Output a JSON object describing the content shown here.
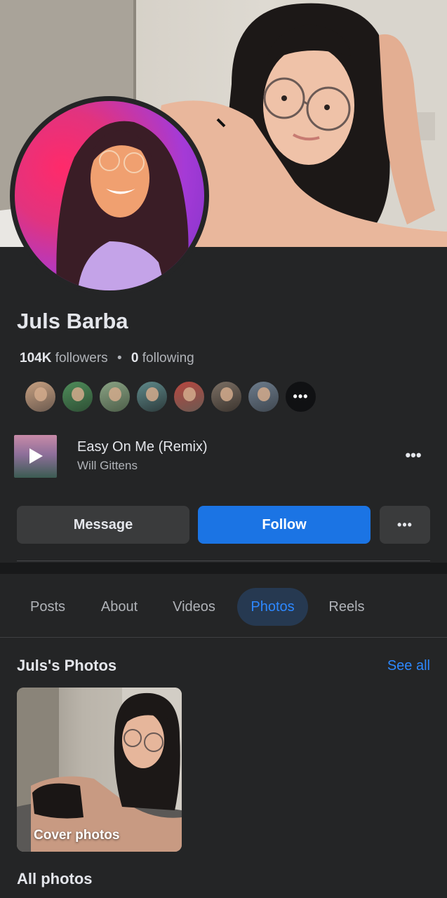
{
  "profile": {
    "name": "Juls Barba",
    "followers_count": "104K",
    "followers_label": "followers",
    "separator": "•",
    "following_count": "0",
    "following_label": "following"
  },
  "friends": {
    "more_label": "•••"
  },
  "music": {
    "title": "Easy On Me (Remix)",
    "artist": "Will Gittens",
    "more_label": "•••"
  },
  "actions": {
    "message_label": "Message",
    "follow_label": "Follow",
    "more_label": "•••"
  },
  "tabs": [
    {
      "label": "Posts",
      "active": false
    },
    {
      "label": "About",
      "active": false
    },
    {
      "label": "Videos",
      "active": false
    },
    {
      "label": "Photos",
      "active": true
    },
    {
      "label": "Reels",
      "active": false
    }
  ],
  "photos": {
    "title": "Juls's Photos",
    "see_all": "See all",
    "album_label": "Cover photos",
    "all_photos": "All photos"
  },
  "colors": {
    "background": "#242526",
    "accent": "#1b74e4",
    "link": "#2d88ff",
    "active_tab_bg": "#263951"
  }
}
